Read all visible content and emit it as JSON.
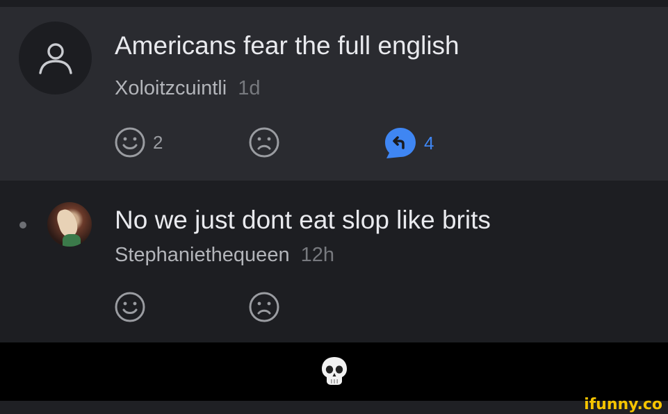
{
  "colors": {
    "accent_blue": "#3f86f3",
    "icon_gray": "#9a9ca1",
    "watermark_yellow": "#f5c400"
  },
  "comments": [
    {
      "text": "Americans fear the full english",
      "username": "Xoloitzcuintli",
      "time": "1d",
      "avatar": "default-user-icon",
      "actions": {
        "smile_count": "2",
        "frown_count": "",
        "reply_count": "4"
      }
    },
    {
      "text": "No we just dont eat slop like brits",
      "username": "Stephaniethequeen",
      "time": "12h",
      "avatar": "profile-photo",
      "actions": {
        "smile_count": "",
        "frown_count": ""
      }
    }
  ],
  "reaction": {
    "emoji_name": "skull-emoji"
  },
  "watermark": "ifunny.co"
}
